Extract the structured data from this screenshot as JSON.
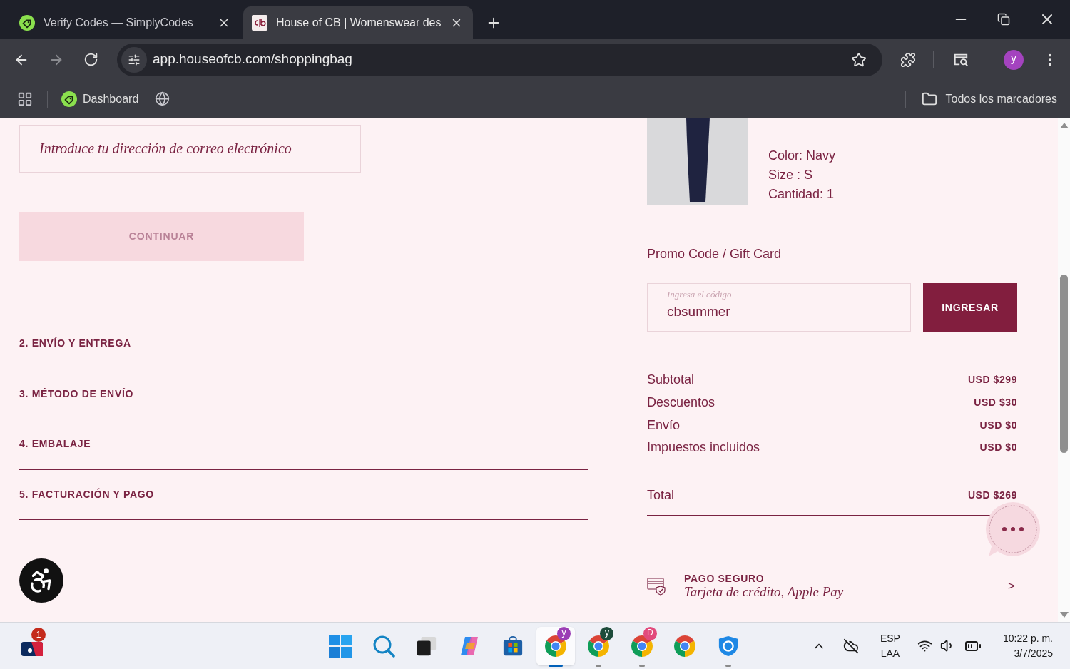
{
  "browser": {
    "tabs": [
      {
        "title": "Verify Codes — SimplyCodes",
        "selected": false
      },
      {
        "title": "House of CB | Womenswear des",
        "selected": true
      }
    ],
    "url": "app.houseofcb.com/shoppingbag",
    "profile_initial": "y",
    "bookmarks": [
      {
        "label": "Dashboard"
      }
    ],
    "all_bookmarks": "Todos los marcadores"
  },
  "checkout": {
    "email_field": {
      "placeholder": "Introduce tu dirección de correo electrónico"
    },
    "continue_button": {
      "label": "CONTINUAR",
      "disabled": true
    },
    "steps": [
      {
        "title": "2. ENVÍO Y ENTREGA"
      },
      {
        "title": "3. MÉTODO DE ENVÍO"
      },
      {
        "title": "4. EMBALAJE"
      },
      {
        "title": "5. FACTURACIÓN Y PAGO"
      }
    ]
  },
  "cart": {
    "item_details": [
      "Color: Navy",
      "Size : S",
      "Cantidad: 1"
    ],
    "promo": {
      "heading": "Promo Code / Gift Card",
      "label": "Ingresa el código",
      "value": "cbsummer",
      "button": "INGRESAR"
    },
    "summary": [
      {
        "label": "Subtotal",
        "value": "USD $299"
      },
      {
        "label": "Descuentos",
        "value": "USD $30"
      },
      {
        "label": "Envío",
        "value": "USD $0"
      },
      {
        "label": "Impuestos incluidos",
        "value": "USD $0"
      }
    ],
    "total": {
      "label": "Total",
      "value": "USD $269"
    },
    "secure_payment": {
      "title": "PAGO SEGURO",
      "methods": "Tarjeta de crédito, Apple Pay",
      "arrow": ">"
    }
  },
  "taskbar": {
    "notification_count": "1",
    "apps": [
      {
        "kind": "windows",
        "selected": false,
        "running": false
      },
      {
        "kind": "search",
        "selected": false,
        "running": false
      },
      {
        "kind": "task_view",
        "selected": false,
        "running": false
      },
      {
        "kind": "copilot",
        "selected": false,
        "running": false
      },
      {
        "kind": "store",
        "selected": false,
        "running": false
      },
      {
        "kind": "chrome",
        "badge": "y",
        "color": "#9b3db5",
        "selected": true,
        "running": true
      },
      {
        "kind": "chrome",
        "badge": "y",
        "color": "#1d4b3a",
        "selected": false,
        "running": true
      },
      {
        "kind": "chrome",
        "badge": "D",
        "color": "#e24a7c",
        "selected": false,
        "running": true
      },
      {
        "kind": "chrome",
        "selected": false,
        "running": false
      },
      {
        "kind": "shield",
        "selected": false,
        "running": true
      }
    ],
    "language": [
      "ESP",
      "LAA"
    ],
    "time": "10:22 p. m.",
    "date": "3/7/2025"
  }
}
